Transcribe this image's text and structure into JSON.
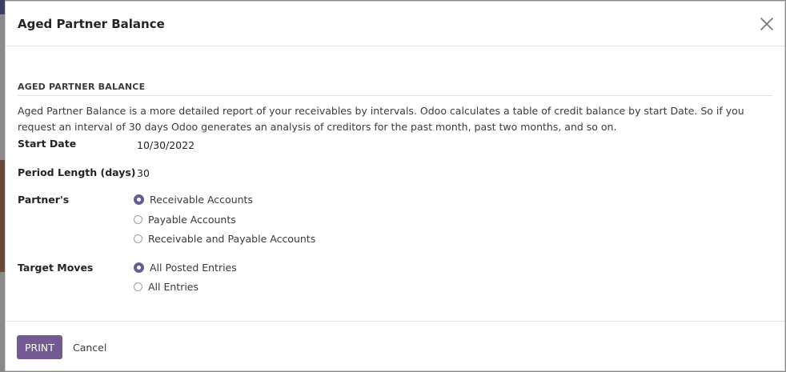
{
  "dialog": {
    "title": "Aged Partner Balance",
    "close_icon": "close-icon"
  },
  "section": {
    "title": "AGED PARTNER BALANCE",
    "description": "Aged Partner Balance is a more detailed report of your receivables by intervals. Odoo calculates a table of credit balance by start Date. So if you request an interval of 30 days Odoo generates an analysis of creditors for the past month, past two months, and so on."
  },
  "fields": {
    "start_date": {
      "label": "Start Date",
      "value": "10/30/2022"
    },
    "period_length": {
      "label": "Period Length (days)",
      "value": "30"
    },
    "partners": {
      "label": "Partner's",
      "options": [
        "Receivable Accounts",
        "Payable Accounts",
        "Receivable and Payable Accounts"
      ],
      "selected": "Receivable Accounts"
    },
    "target_moves": {
      "label": "Target Moves",
      "options": [
        "All Posted Entries",
        "All Entries"
      ],
      "selected": "All Posted Entries"
    }
  },
  "footer": {
    "print_label": "PRINT",
    "cancel_label": "Cancel"
  },
  "colors": {
    "primary": "#735a93",
    "radio_checked": "#6b5b95"
  }
}
